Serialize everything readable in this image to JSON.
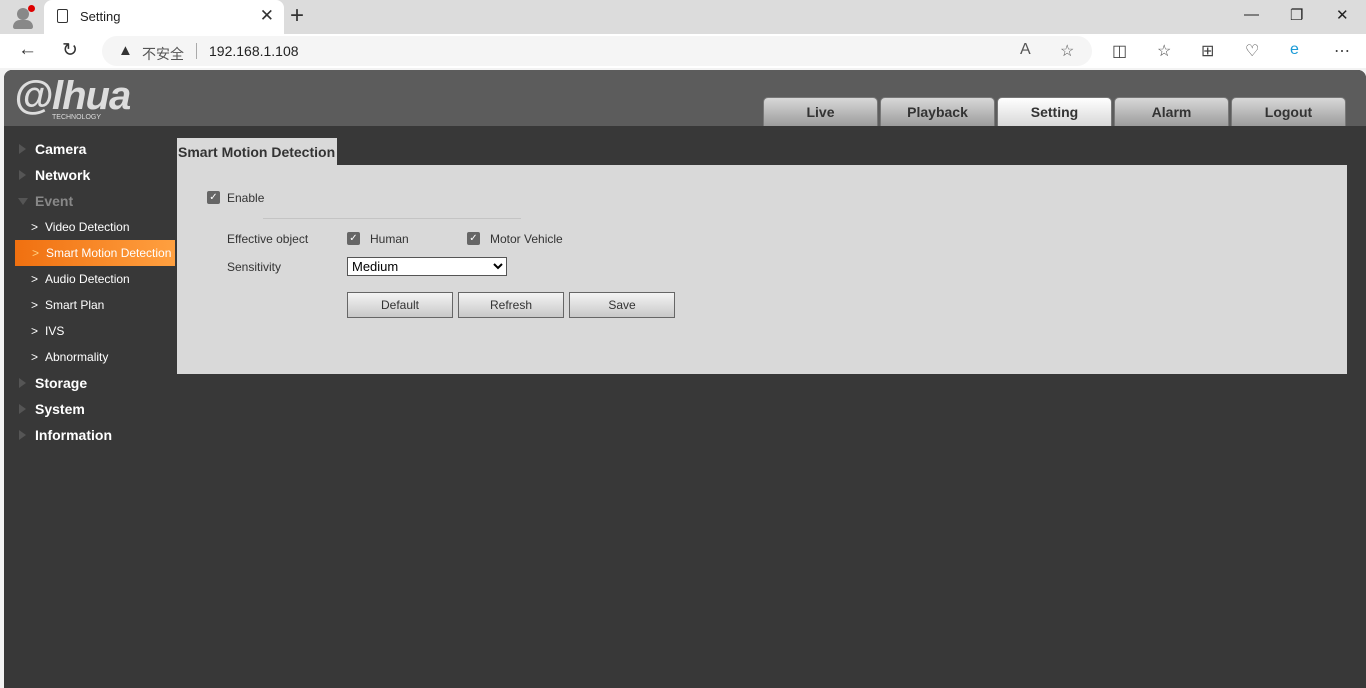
{
  "browser": {
    "tab_title": "Setting",
    "security_label": "不安全",
    "url": "192.168.1.108"
  },
  "app": {
    "logo": "alhua",
    "logo_sub": "TECHNOLOGY",
    "main_tabs": [
      {
        "label": "Live"
      },
      {
        "label": "Playback"
      },
      {
        "label": "Setting",
        "active": true
      },
      {
        "label": "Alarm"
      },
      {
        "label": "Logout"
      }
    ]
  },
  "sidebar": {
    "camera": "Camera",
    "network": "Network",
    "event": "Event",
    "event_items": [
      "Video Detection",
      "Smart Motion Detection",
      "Audio Detection",
      "Smart Plan",
      "IVS",
      "Abnormality"
    ],
    "storage": "Storage",
    "system": "System",
    "information": "Information"
  },
  "page": {
    "title": "Smart Motion Detection",
    "enable_label": "Enable",
    "enable_checked": true,
    "effective_object_label": "Effective object",
    "human_label": "Human",
    "human_checked": true,
    "vehicle_label": "Motor Vehicle",
    "vehicle_checked": true,
    "sensitivity_label": "Sensitivity",
    "sensitivity_value": "Medium",
    "default_btn": "Default",
    "refresh_btn": "Refresh",
    "save_btn": "Save"
  },
  "colors": {
    "accent": "#f58220",
    "bg": "#383838",
    "panel": "#d9d9d9"
  }
}
